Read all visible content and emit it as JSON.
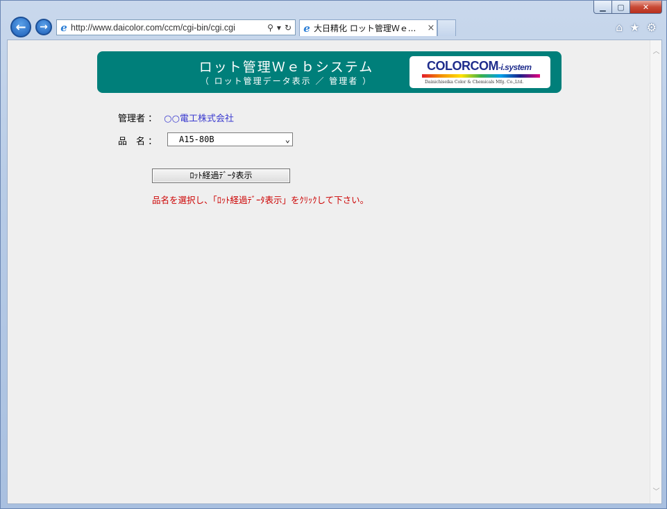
{
  "browser": {
    "url": "http://www.daicolor.com/ccm/cgi-bin/cgi.cgi",
    "tab_title": "大日精化 ロット管理Ｗｅ...",
    "tab_close": "×"
  },
  "icons": {
    "back": "back-arrow-icon",
    "forward": "forward-arrow-icon",
    "search": "search-icon",
    "refresh": "refresh-icon",
    "home": "home-icon",
    "favorites": "star-icon",
    "settings": "gear-icon"
  },
  "header": {
    "title": "ロット管理Ｗｅｂシステム",
    "subtitle": "（ ロット管理データ表示 ／ 管理者 ）",
    "logo_main": "COLORCOM",
    "logo_suffix": "-i.system",
    "logo_sub": "Dainichiseika Color & Chemicals Mfg. Co.,Ltd."
  },
  "form": {
    "admin_label": "管理者 ：",
    "admin_value": "○○電工株式会社",
    "product_label": "品　名 ：",
    "product_value": "A15-80B",
    "submit_label": "ﾛｯﾄ経過ﾃﾞｰﾀ表示",
    "instruction": "品名を選択し、「ﾛｯﾄ経過ﾃﾞｰﾀ表示」をｸﾘｯｸして下さい。"
  },
  "colors": {
    "banner": "#007f7a",
    "admin_value": "#3a3acf",
    "instruction": "#cc0000"
  }
}
